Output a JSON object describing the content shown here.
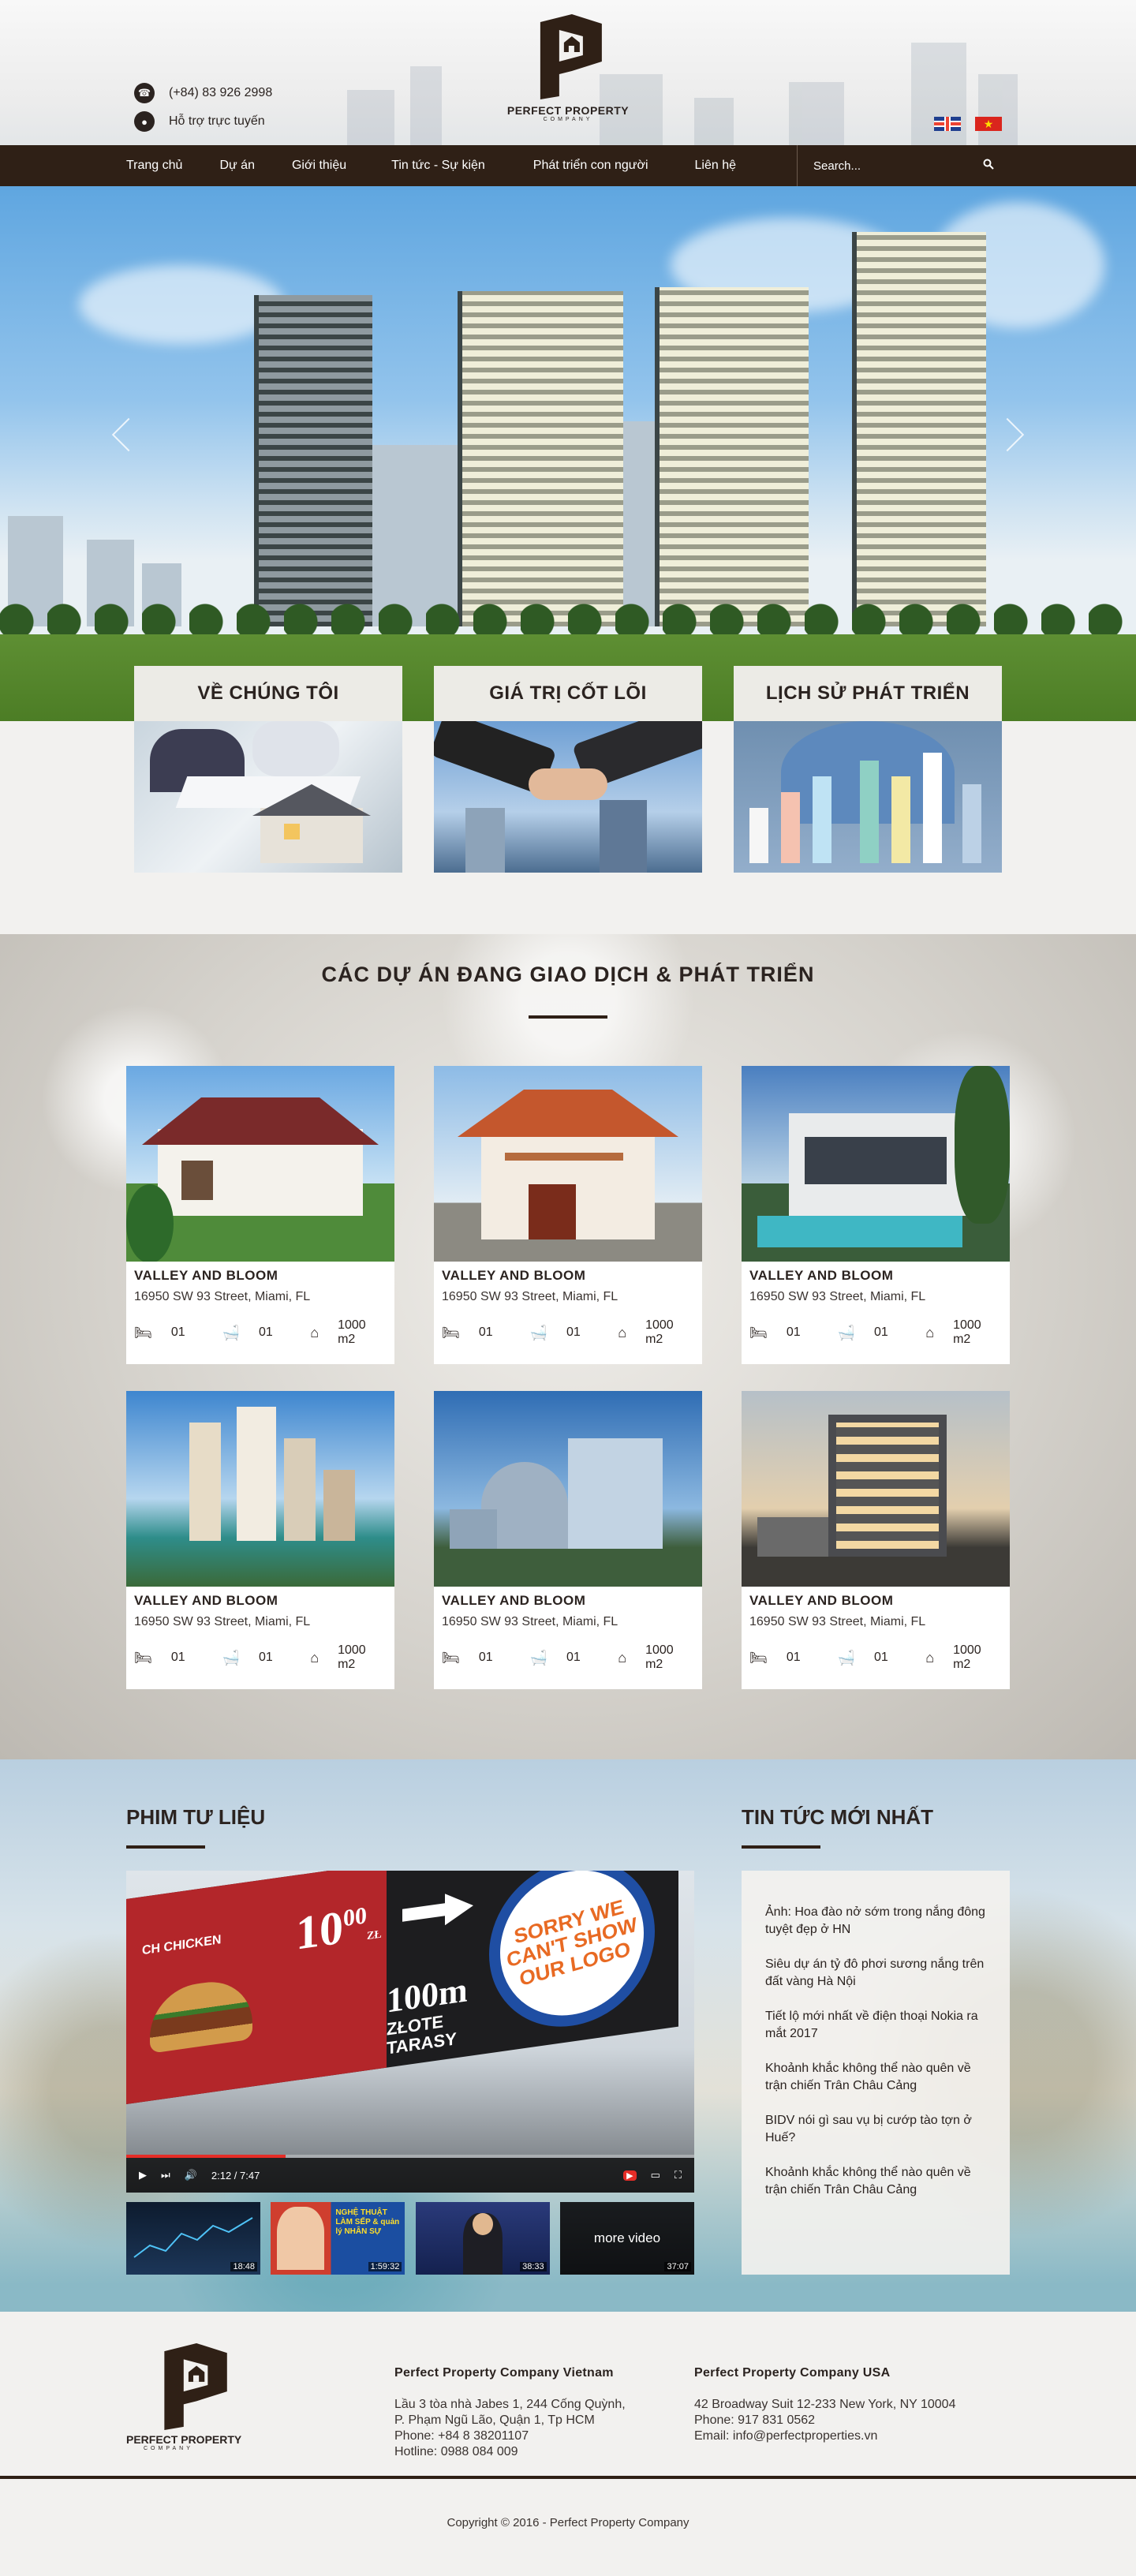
{
  "header": {
    "phone": "(+84) 83 926 2998",
    "support": "Hỗ trợ trực tuyến",
    "logo_name": "PERFECT PROPERTY",
    "logo_sub": "COMPANY",
    "languages": [
      "en-flag",
      "vn-flag"
    ]
  },
  "nav": {
    "items": [
      "Trang chủ",
      "Dự án",
      "Giới thiệu",
      "Tin tức - Sự kiện",
      "Phát triển con người",
      "Liên hệ"
    ],
    "search_placeholder": "Search..."
  },
  "features": [
    {
      "title": "VỀ CHÚNG TÔI"
    },
    {
      "title": "GIÁ TRỊ CỐT LÕI"
    },
    {
      "title": "LỊCH SỬ PHÁT TRIỂN"
    }
  ],
  "projects": {
    "title": "CÁC DỰ ÁN ĐANG GIAO DỊCH & PHÁT TRIỂN",
    "items": [
      {
        "name": "VALLEY AND BLOOM",
        "address": "16950 SW 93 Street, Miami, FL",
        "beds": "01",
        "baths": "01",
        "area": "1000 m2"
      },
      {
        "name": "VALLEY AND BLOOM",
        "address": "16950 SW 93 Street, Miami, FL",
        "beds": "01",
        "baths": "01",
        "area": "1000 m2"
      },
      {
        "name": "VALLEY AND BLOOM",
        "address": "16950 SW 93 Street, Miami, FL",
        "beds": "01",
        "baths": "01",
        "area": "1000 m2"
      },
      {
        "name": "VALLEY AND BLOOM",
        "address": "16950 SW 93 Street, Miami, FL",
        "beds": "01",
        "baths": "01",
        "area": "1000 m2"
      },
      {
        "name": "VALLEY AND BLOOM",
        "address": "16950 SW 93 Street, Miami, FL",
        "beds": "01",
        "baths": "01",
        "area": "1000 m2"
      },
      {
        "name": "VALLEY AND BLOOM",
        "address": "16950 SW 93 Street, Miami, FL",
        "beds": "01",
        "baths": "01",
        "area": "1000 m2"
      }
    ]
  },
  "videos": {
    "title": "PHIM TƯ LIỆU",
    "player": {
      "time": "2:12 / 7:47",
      "progress": 0.28,
      "billboard": {
        "brand": "CH CHICKEN",
        "price": "10",
        "price_sup": "00",
        "price_unit": "ZŁ",
        "distance": "100m",
        "street_1": "ZŁOTE",
        "street_2": "TARASY",
        "logo_text": "SORRY WE CAN'T SHOW OUR LOGO"
      }
    },
    "thumbs": [
      {
        "duration": "18:48",
        "text": ""
      },
      {
        "duration": "1:59:32",
        "text": "NGHỆ THUẬT LÀM SẾP & quản lý NHÂN SỰ"
      },
      {
        "duration": "38:33",
        "text": ""
      },
      {
        "duration": "37:07",
        "text": "more video"
      }
    ]
  },
  "news": {
    "title": "TIN TỨC MỚI NHẤT",
    "items": [
      "Ảnh: Hoa đào nở sớm trong nắng đông tuyệt đẹp ở HN",
      "Siêu dự án tỷ đô phơi sương nắng trên đất vàng Hà Nội",
      "Tiết lộ mới nhất về điện thoại Nokia ra mắt 2017",
      "Khoảnh khắc không thể nào quên về trận chiến Trân Châu Cảng",
      "BIDV nói gì sau vụ bị cướp tào tợn ở Huế?",
      "Khoảnh khắc không thể nào quên về trận chiến Trân Châu Cảng"
    ]
  },
  "footer": {
    "vn": {
      "title": "Perfect Property Company Vietnam",
      "lines": [
        "Lầu 3 tòa nhà Jabes 1, 244 Cống Quỳnh,",
        "P. Phạm Ngũ Lão, Quận 1, Tp HCM",
        "Phone: +84 8 38201107",
        "Hotline: 0988 084 009"
      ]
    },
    "usa": {
      "title": "Perfect Property Company USA",
      "lines": [
        "42 Broadway Suit 12-233 New York, NY 10004",
        "Phone: 917 831 0562",
        "Email: info@perfectproperties.vn"
      ]
    },
    "copyright": "Copyright © 2016 - Perfect Property Company"
  },
  "colors": {
    "brand_dark": "#2f2016",
    "accent_red": "#e52d27"
  }
}
